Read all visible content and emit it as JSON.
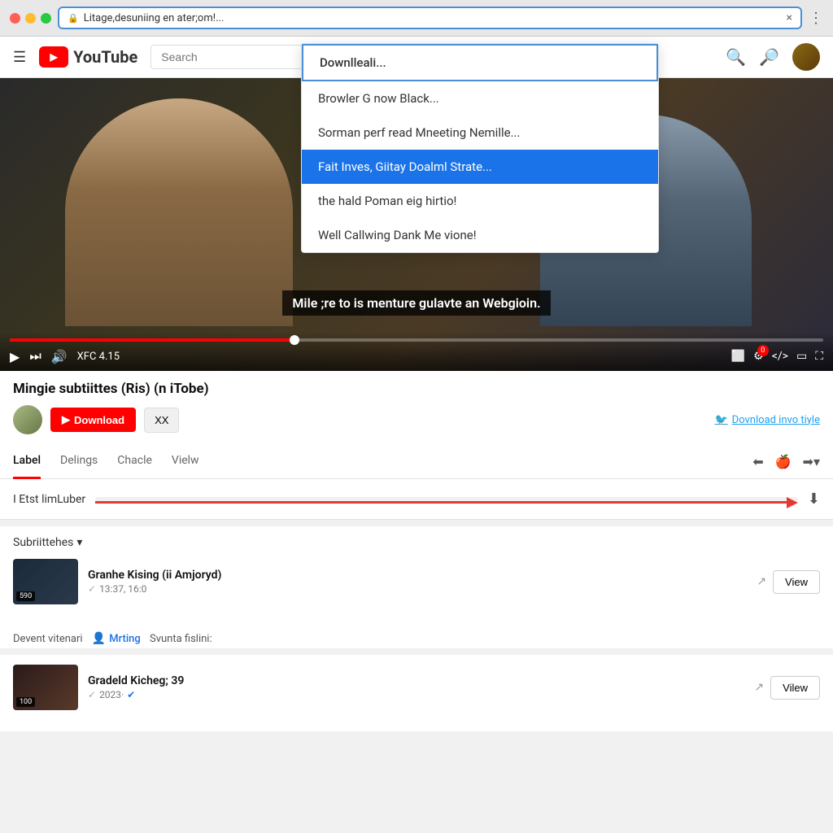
{
  "browser": {
    "address": "Litage,desuniing en ater;om!...",
    "close_label": "×",
    "more_label": "⋮"
  },
  "youtube": {
    "logo_text": "YouTube",
    "search_placeholder": "Search",
    "hamburger_label": "☰"
  },
  "dropdown": {
    "items": [
      {
        "label": "Downlleali...",
        "state": "top"
      },
      {
        "label": "Browler G now Black...",
        "state": "normal"
      },
      {
        "label": "Sorman perf read Mneeting Nemille...",
        "state": "normal"
      },
      {
        "label": "Fait Inves, Giitay Doalml Strate...",
        "state": "active"
      },
      {
        "label": "the hald Poman eig hirtio!",
        "state": "normal"
      },
      {
        "label": "Well Callwing Dank Me vione!",
        "state": "normal"
      }
    ]
  },
  "video": {
    "subtitle": "Mile ;re to is menture gulavte an Webgioin.",
    "time_code": "XFC 4.15",
    "badge_count": "0"
  },
  "video_info": {
    "title": "Mingie subtiittes (Ris) (n iTobe)",
    "download_label": "Download",
    "xx_label": "XX",
    "twitter_link": "Dovnload invo tiyle"
  },
  "tabs": {
    "items": [
      {
        "label": "Label",
        "active": true
      },
      {
        "label": "Delings",
        "active": false
      },
      {
        "label": "Chacle",
        "active": false
      },
      {
        "label": "Vielw",
        "active": false
      }
    ]
  },
  "progress": {
    "label": "I Etst limLuber"
  },
  "suggestions": {
    "header": "Subriittehes",
    "items": [
      {
        "title": "Granhe Kising (ii Amjoryd)",
        "meta": "13:37, 16:0",
        "badge": "590",
        "action": "View"
      }
    ]
  },
  "divider": {
    "prefix": "Devent vitenari",
    "link": "Mrting",
    "suffix": "Svunta fislini:"
  },
  "suggestion2": {
    "title": "Gradeld Kicheg; 39",
    "meta": "2023·",
    "action": "Vilew",
    "badge": "100"
  }
}
